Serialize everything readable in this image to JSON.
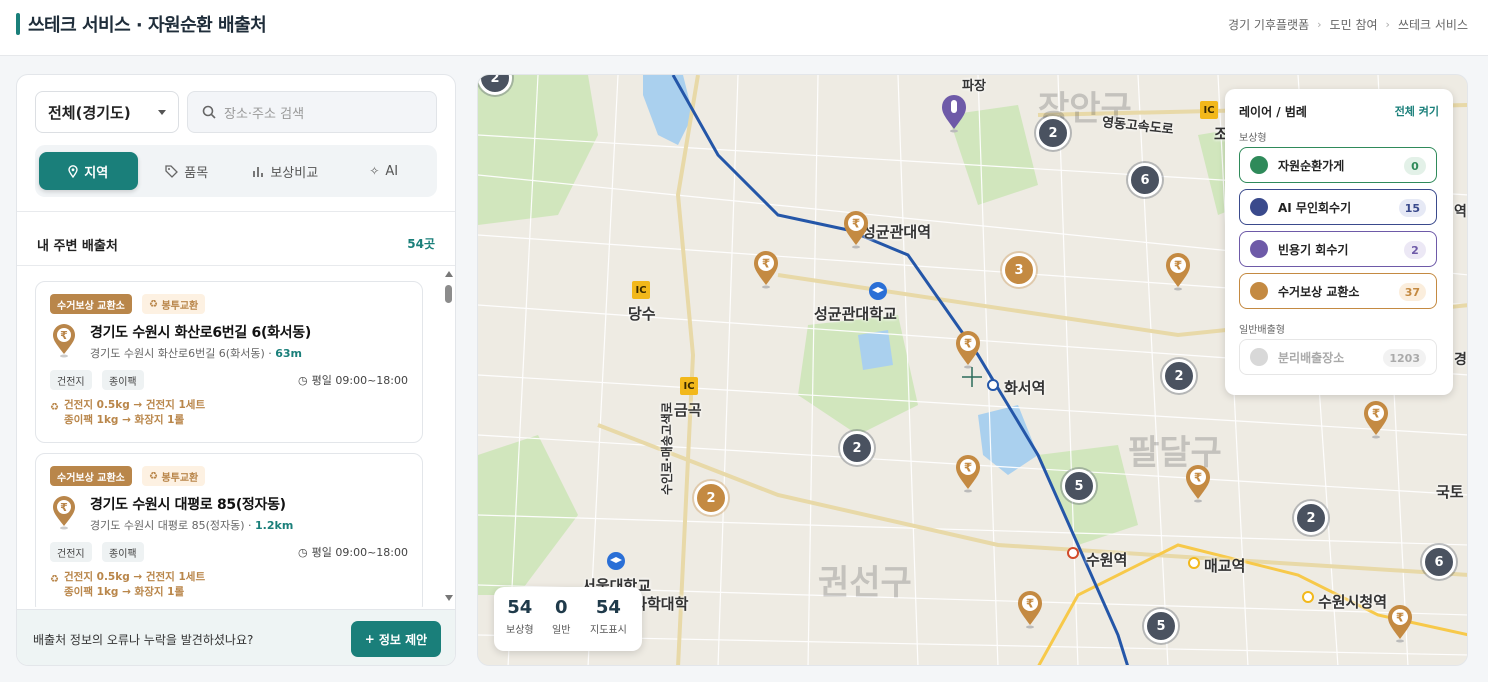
{
  "header": {
    "title": "쓰테크 서비스 · 자원순환 배출처",
    "breadcrumb": [
      "경기 기후플랫폼",
      "도민 참여",
      "쓰테크 서비스"
    ]
  },
  "sidebar": {
    "region_select": "전체(경기도)",
    "search_placeholder": "장소·주소 검색",
    "tabs": [
      {
        "label": "지역",
        "icon": "pin-icon",
        "active": true
      },
      {
        "label": "품목",
        "icon": "tag-icon",
        "active": false
      },
      {
        "label": "보상비교",
        "icon": "bar-chart-icon",
        "active": false
      },
      {
        "label": "AI",
        "icon": "sparkle-icon",
        "active": false
      }
    ],
    "list_title": "내 주변 배출처",
    "list_count": "54곳",
    "cards": [
      {
        "badge": "수거보상 교환소",
        "sub_badge": "봉투교환",
        "title": "경기도 수원시 화산로6번길 6(화서동)",
        "address": "경기도 수원시 화산로6번길 6(화서동)",
        "distance": "63m",
        "tags": [
          "건전지",
          "종이팩"
        ],
        "hours": "평일 09:00~18:00",
        "exchange": [
          "건전지 0.5kg → 건전지 1세트",
          "종이팩 1kg → 화장지 1롤"
        ]
      },
      {
        "badge": "수거보상 교환소",
        "sub_badge": "봉투교환",
        "title": "경기도 수원시 대평로 85(정자동)",
        "address": "경기도 수원시 대평로 85(정자동)",
        "distance": "1.2km",
        "tags": [
          "건전지",
          "종이팩"
        ],
        "hours": "평일 09:00~18:00",
        "exchange": [
          "건전지 0.5kg → 건전지 1세트",
          "종이팩 1kg → 화장지 1롤"
        ]
      }
    ],
    "footer_text": "배출처 정보의 오류나 누락을 발견하셨나요?",
    "suggest_button": "정보 제안"
  },
  "map": {
    "labels": {
      "station_seonggyun": "성균관대역",
      "station_hwaseo": "화서역",
      "station_suwon": "수원역",
      "station_maegyo": "매교역",
      "station_cityhall": "수원시청역",
      "dangsu": "당수",
      "geumgok": "금곡",
      "university": "성균관대학교",
      "university2_a": "서울대학교",
      "university2_b": "농업생명과학대학",
      "highway": "영동고속도로",
      "jowon": "조원",
      "gukto": "국토",
      "road_v": "수인로·매송고색로",
      "district1": "장안구",
      "district2": "팔달구",
      "district3": "권선구",
      "top_partial": "파장",
      "right_partial_1": "역",
      "right_partial_2": "경"
    },
    "clusters": [
      "2",
      "2",
      "6",
      "3",
      "2",
      "2",
      "2",
      "5",
      "2",
      "6",
      "5"
    ],
    "legend": {
      "title": "레이어 / 범례",
      "toggle_all": "전체 켜기",
      "group_reward": "보상형",
      "group_general": "일반배출형",
      "items": [
        {
          "label": "자원순환가게",
          "count": "0",
          "color": "#2f8a5a"
        },
        {
          "label": "AI 무인회수기",
          "count": "15",
          "color": "#3a4a8c"
        },
        {
          "label": "빈용기 회수기",
          "count": "2",
          "color": "#6e5aa8"
        },
        {
          "label": "수거보상 교환소",
          "count": "37",
          "color": "#c48a42"
        },
        {
          "label": "분리배출장소",
          "count": "1203",
          "color": "#bbbbbb"
        }
      ]
    },
    "stats": [
      {
        "value": "54",
        "label": "보상형"
      },
      {
        "value": "0",
        "label": "일반"
      },
      {
        "value": "54",
        "label": "지도표시"
      }
    ]
  }
}
